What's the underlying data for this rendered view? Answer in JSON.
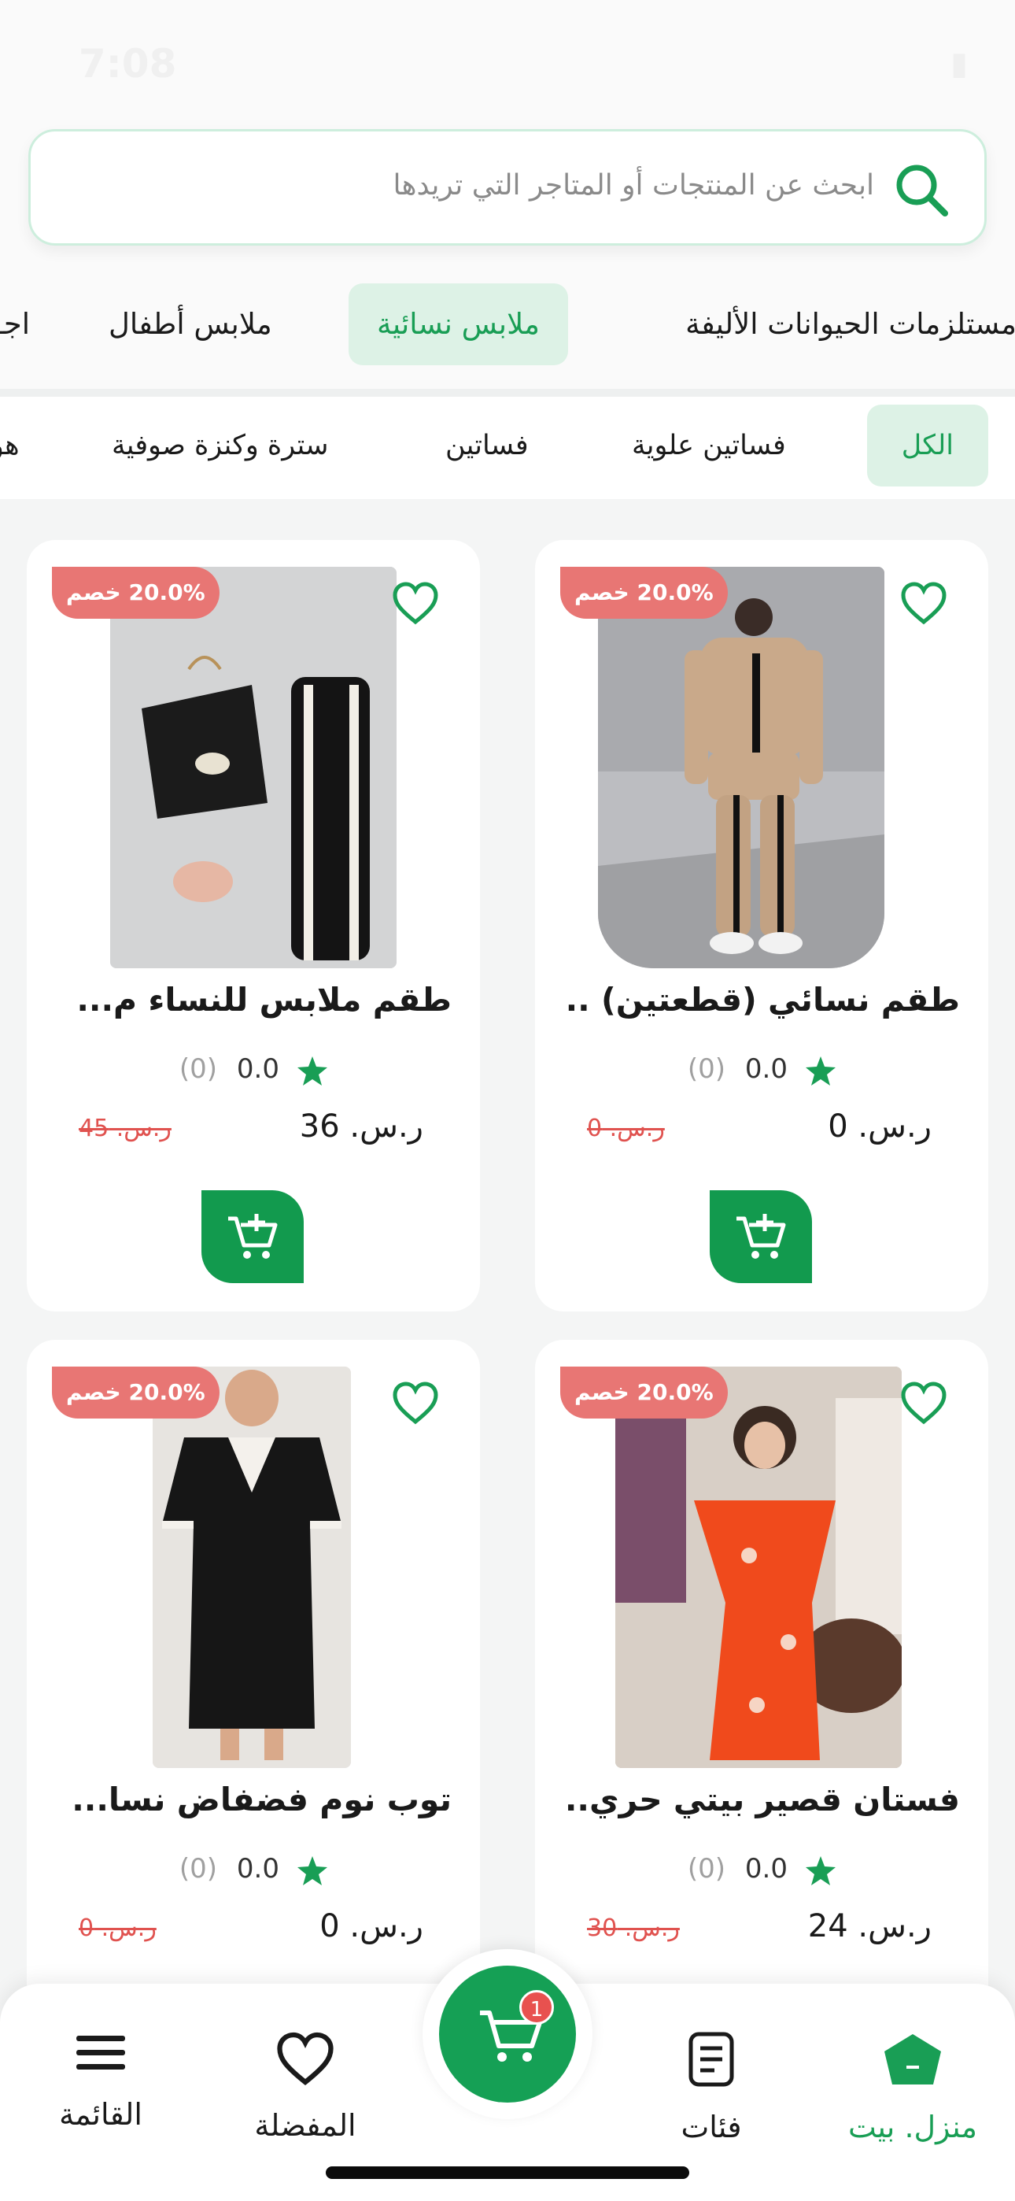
{
  "status_bar": {
    "time": "7:08"
  },
  "search": {
    "placeholder": "ابحث عن المنتجات أو المتاجر التي تريدها"
  },
  "categories": [
    {
      "label": "مستلزمات الحيوانات الأليفة",
      "active": false
    },
    {
      "label": "ملابس نسائية",
      "active": true
    },
    {
      "label": "ملابس أطفال",
      "active": false
    },
    {
      "label": "اجـ",
      "active": false
    }
  ],
  "subcategories": [
    {
      "label": "الكل",
      "active": true
    },
    {
      "label": "فساتين علوية",
      "active": false
    },
    {
      "label": "فساتين",
      "active": false
    },
    {
      "label": "سترة وكنزة صوفية",
      "active": false
    },
    {
      "label": "هو",
      "active": false
    }
  ],
  "products": [
    {
      "title": "طقم نسائي (قطعتين) ...",
      "badge": "20.0% خصم",
      "rating": "0.0",
      "rating_count": "(0)",
      "price": "ر.س. 0",
      "old_price": "ر.س. 0"
    },
    {
      "title": "طقم ملابس للنساء م...",
      "badge": "20.0% خصم",
      "rating": "0.0",
      "rating_count": "(0)",
      "price": "ر.س. 36",
      "old_price": "ر.س. 45"
    },
    {
      "title": "فستان قصير بيتي حري...",
      "badge": "20.0% خصم",
      "rating": "0.0",
      "rating_count": "(0)",
      "price": "ر.س. 24",
      "old_price": "ر.س. 30"
    },
    {
      "title": "توب نوم فضفاض نسا...",
      "badge": "20.0% خصم",
      "rating": "0.0",
      "rating_count": "(0)",
      "price": "ر.س. 0",
      "old_price": "ر.س. 0"
    }
  ],
  "bottom_nav": {
    "home": "منزل. بيت",
    "categories": "فئات",
    "favorites": "المفضلة",
    "menu": "القائمة",
    "cart_count": "1"
  },
  "colors": {
    "accent": "#199e55",
    "badge": "#e87674",
    "cart_button": "#129a4e"
  }
}
